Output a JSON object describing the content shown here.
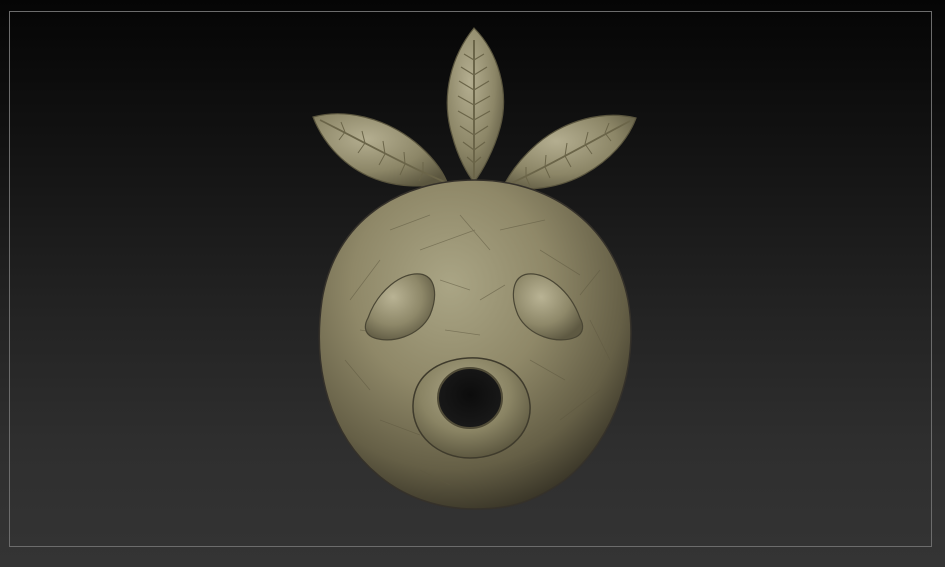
{
  "viewport": {
    "background_top": "#050505",
    "background_bottom": "#343434",
    "frame_color": "#6c6c6c"
  },
  "model": {
    "name": "mask-model",
    "material_color": "#8f8868",
    "shadow_color": "#3e3a2c",
    "highlight_color": "#b7b194"
  }
}
